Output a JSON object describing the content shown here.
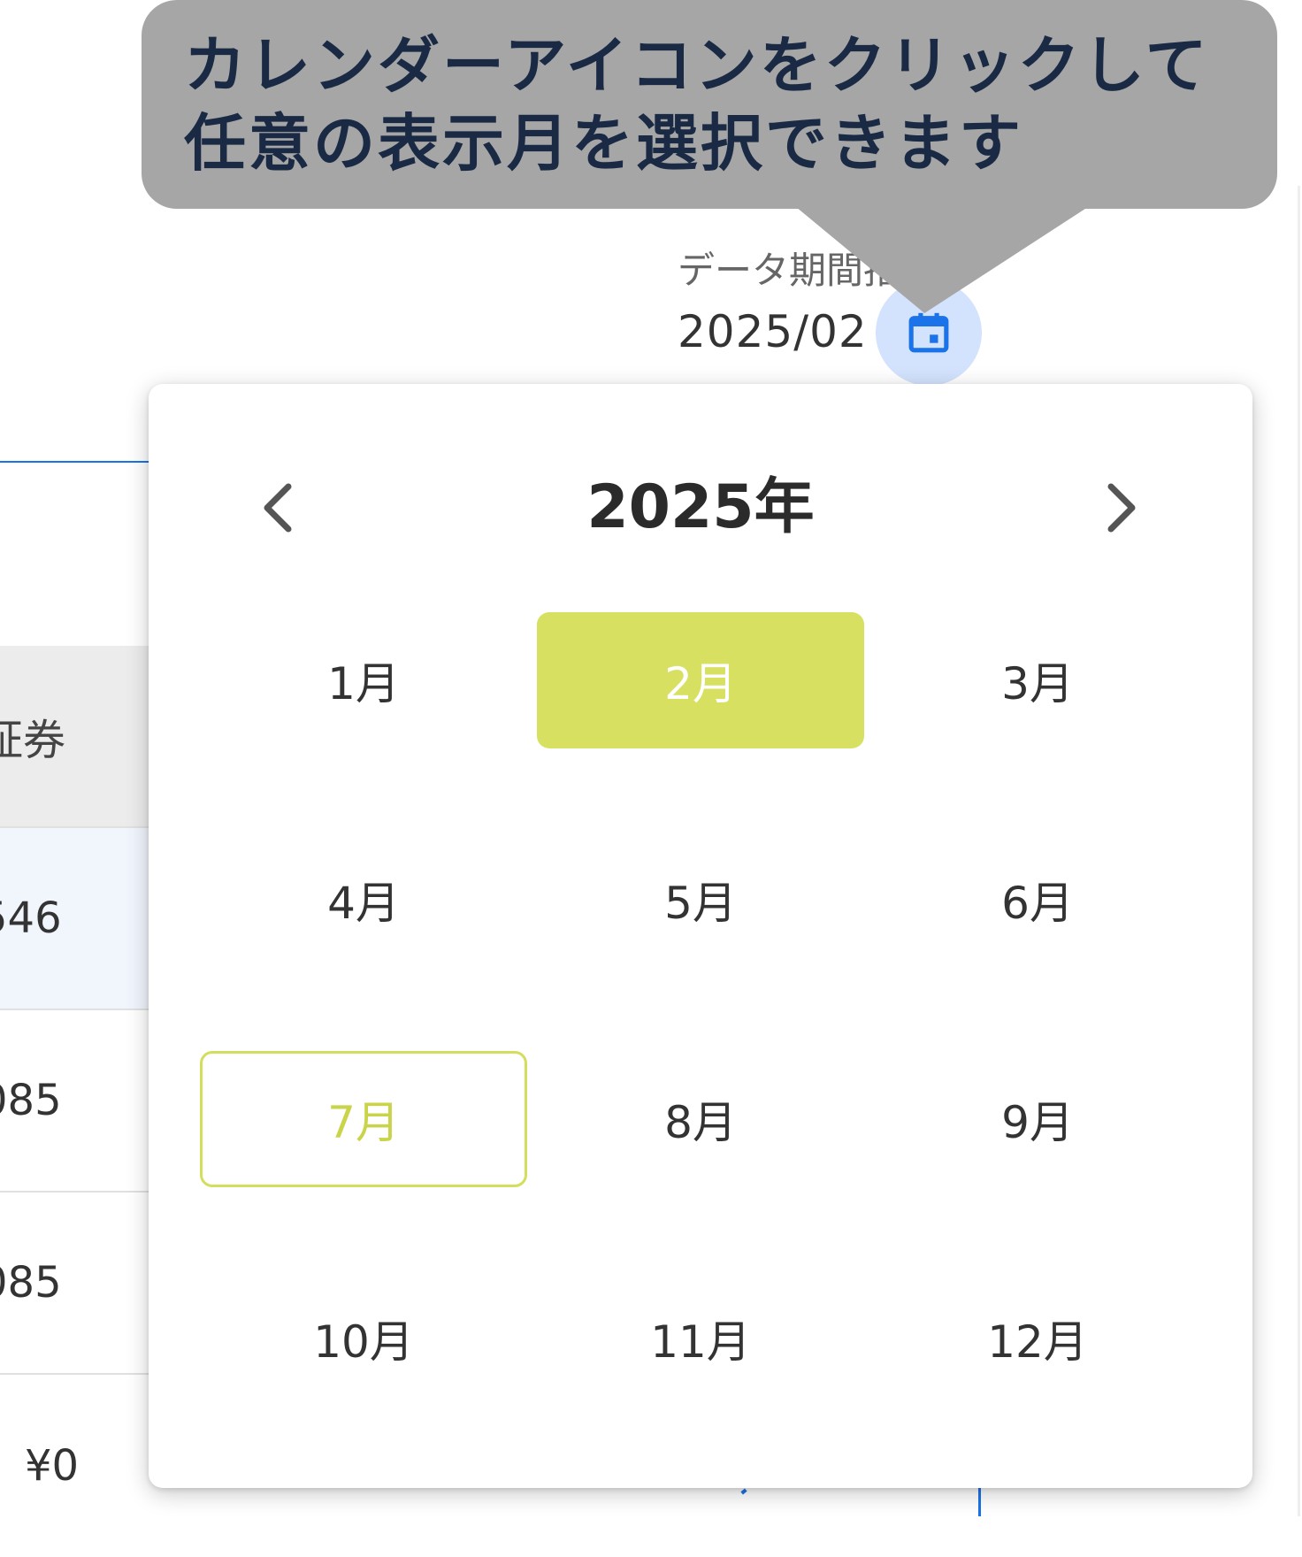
{
  "callout": {
    "line1": "カレンダーアイコンをクリックして",
    "line2": "任意の表示月を選択できます"
  },
  "period": {
    "label": "データ期間指",
    "value": "2025/02"
  },
  "calendar_button": {
    "icon": "calendar-icon",
    "color": "#1a73e8",
    "bg": "#d3e3fd"
  },
  "background_table": {
    "header": "証券",
    "rows": [
      "546",
      "085",
      "085",
      "¥0"
    ]
  },
  "picker": {
    "year": "2025年",
    "prev_icon": "chevron-left-icon",
    "next_icon": "chevron-right-icon",
    "months": [
      "1月",
      "2月",
      "3月",
      "4月",
      "5月",
      "6月",
      "7月",
      "8月",
      "9月",
      "10月",
      "11月",
      "12月"
    ],
    "selected_month": "2月",
    "current_month": "7月",
    "selected_color": "#d8e062",
    "current_color": "#c9d44a"
  }
}
